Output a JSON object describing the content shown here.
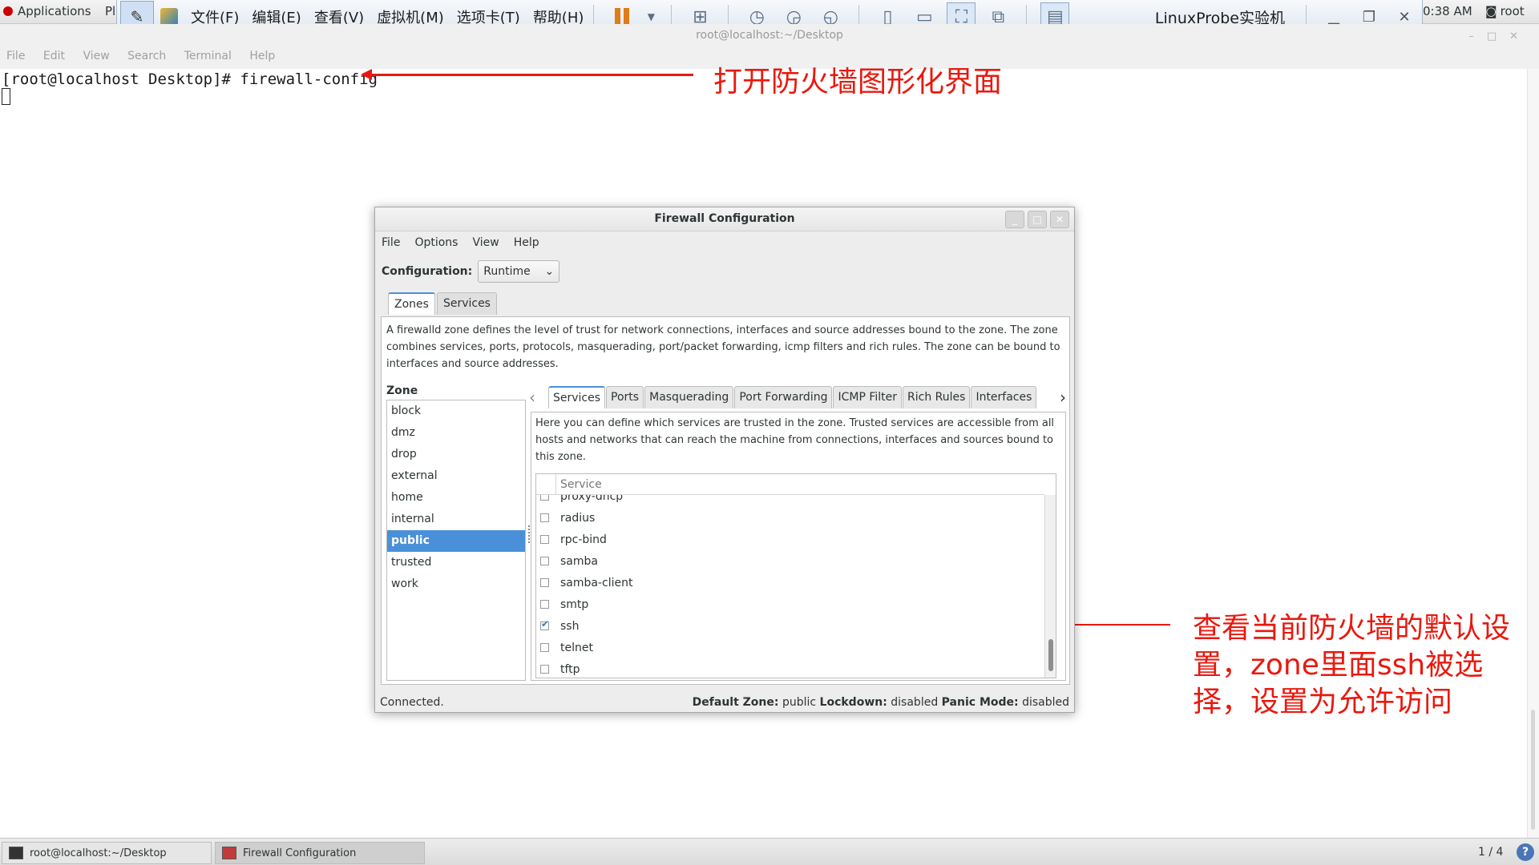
{
  "gnome_panel": {
    "applications": "Applications",
    "places_partial": "Pl",
    "clock": "0:38 AM",
    "user": "root"
  },
  "vm_toolbar": {
    "menus": [
      "文件(F)",
      "编辑(E)",
      "查看(V)",
      "虚拟机(M)",
      "选项卡(T)",
      "帮助(H)"
    ],
    "title": "LinuxProbe实验机"
  },
  "terminal": {
    "title": "root@localhost:~/Desktop",
    "menus": [
      "File",
      "Edit",
      "View",
      "Search",
      "Terminal",
      "Help"
    ],
    "prompt": "[root@localhost Desktop]# firewall-config"
  },
  "annotations": {
    "top": "打开防火墙图形化界面",
    "bottom": "查看当前防火墙的默认设置，zone里面ssh被选择，设置为允许访问"
  },
  "firewall": {
    "title": "Firewall Configuration",
    "menus": [
      "File",
      "Options",
      "View",
      "Help"
    ],
    "config_label": "Configuration:",
    "config_value": "Runtime",
    "main_tabs": [
      "Zones",
      "Services"
    ],
    "zone_description": "A firewalld zone defines the level of trust for network connections, interfaces and source addresses bound to the zone. The zone combines services, ports, protocols, masquerading, port/packet forwarding, icmp filters and rich rules. The zone can be bound to interfaces and source addresses.",
    "zone_label": "Zone",
    "zones": [
      "block",
      "dmz",
      "drop",
      "external",
      "home",
      "internal",
      "public",
      "trusted",
      "work"
    ],
    "selected_zone": "public",
    "sub_tabs": [
      "Services",
      "Ports",
      "Masquerading",
      "Port Forwarding",
      "ICMP Filter",
      "Rich Rules",
      "Interfaces"
    ],
    "services_description": "Here you can define which services are trusted in the zone. Trusted services are accessible from all hosts and networks that can reach the machine from connections, interfaces and sources bound to this zone.",
    "service_column": "Service",
    "services": [
      {
        "name": "proxy-dhcp",
        "checked": false
      },
      {
        "name": "radius",
        "checked": false
      },
      {
        "name": "rpc-bind",
        "checked": false
      },
      {
        "name": "samba",
        "checked": false
      },
      {
        "name": "samba-client",
        "checked": false
      },
      {
        "name": "smtp",
        "checked": false
      },
      {
        "name": "ssh",
        "checked": true
      },
      {
        "name": "telnet",
        "checked": false
      },
      {
        "name": "tftp",
        "checked": false
      }
    ],
    "status": {
      "connection": "Connected.",
      "default_zone_label": "Default Zone:",
      "default_zone": "public",
      "lockdown_label": "Lockdown:",
      "lockdown": "disabled",
      "panic_label": "Panic Mode:",
      "panic": "disabled"
    }
  },
  "taskbar": {
    "tasks": [
      "root@localhost:~/Desktop",
      "Firewall Configuration"
    ],
    "workspace": "1 / 4"
  }
}
